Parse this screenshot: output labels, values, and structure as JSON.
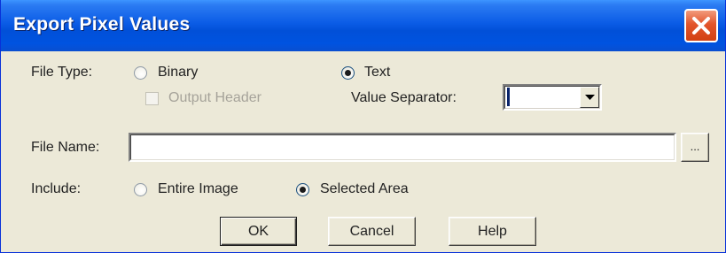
{
  "window": {
    "title": "Export Pixel Values",
    "close_icon": "close-x-icon"
  },
  "file_type": {
    "label": "File Type:",
    "options": [
      {
        "label": "Binary",
        "selected": false
      },
      {
        "label": "Text",
        "selected": true
      }
    ],
    "output_header": {
      "label": "Output Header",
      "checked": false,
      "enabled": false
    },
    "value_separator": {
      "label": "Value Separator:",
      "value": ""
    }
  },
  "file_name": {
    "label": "File Name:",
    "value": "",
    "browse_label": "..."
  },
  "include": {
    "label": "Include:",
    "options": [
      {
        "label": "Entire Image",
        "selected": false
      },
      {
        "label": "Selected Area",
        "selected": true
      }
    ]
  },
  "buttons": {
    "ok": "OK",
    "cancel": "Cancel",
    "help": "Help"
  },
  "colors": {
    "titlebar": "#0053e0",
    "dialog_bg": "#ece9d8",
    "close_button": "#e2552c"
  }
}
